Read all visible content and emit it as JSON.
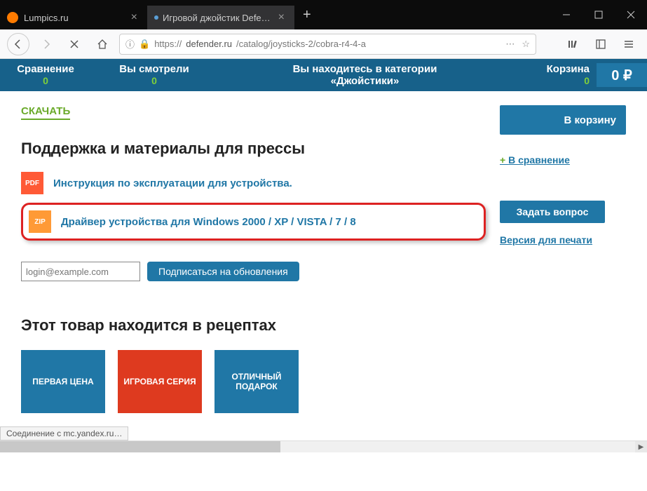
{
  "tabs": {
    "lumpics": "Lumpics.ru",
    "defender": "Игровой джойстик Defender C"
  },
  "url": {
    "scheme": "https://",
    "host": "defender.ru",
    "path": "/catalog/joysticks-2/cobra-r4-4-a"
  },
  "bluebar": {
    "compare": {
      "label": "Сравнение",
      "value": "0"
    },
    "viewed": {
      "label": "Вы смотрели",
      "value": "0"
    },
    "category": {
      "line1": "Вы находитесь в категории",
      "line2": "«Джойстики»"
    },
    "cart": {
      "label": "Корзина",
      "value": "0"
    },
    "sum": "0 ₽"
  },
  "main": {
    "download": "СКАЧАТЬ",
    "support_title": "Поддержка и материалы для прессы",
    "pdf_badge": "PDF",
    "pdf_label": "Инструкция по эксплуатации для устройства.",
    "zip_badge": "ZIP",
    "zip_label": "Драйвер устройства для Windows 2000 / XP / VISTA / 7 / 8",
    "email_placeholder": "login@example.com",
    "subscribe": "Подписаться на обновления",
    "recipes_title": "Этот товар находится в рецептах",
    "recipes": [
      "ПЕРВАЯ ЦЕНА",
      "ИГРОВАЯ СЕРИЯ",
      "ОТЛИЧНЫЙ ПОДАРОК"
    ]
  },
  "side": {
    "cart_btn": "В корзину",
    "compare": "В сравнение",
    "ask": "Задать вопрос",
    "print": "Версия для печати"
  },
  "status": "Соединение с mc.yandex.ru…"
}
